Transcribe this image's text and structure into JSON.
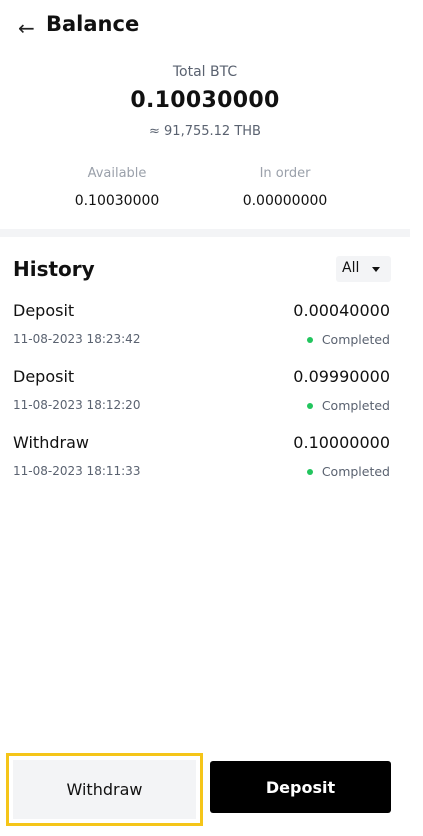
{
  "header": {
    "back_icon": "arrow-left-icon",
    "title": "Balance"
  },
  "summary": {
    "total_label": "Total BTC",
    "total_value": "0.10030000",
    "total_fiat": "≈ 91,755.12 THB",
    "available_label": "Available",
    "available_value": "0.10030000",
    "in_order_label": "In order",
    "in_order_value": "0.00000000"
  },
  "history": {
    "title": "History",
    "filter": {
      "selected": "All",
      "icon": "caret-down-icon"
    },
    "items": [
      {
        "type": "Deposit",
        "datetime": "11-08-2023  18:23:42",
        "amount": "0.00040000",
        "status": "Completed"
      },
      {
        "type": "Deposit",
        "datetime": "11-08-2023  18:12:20",
        "amount": "0.09990000",
        "status": "Completed"
      },
      {
        "type": "Withdraw",
        "datetime": "11-08-2023  18:11:33",
        "amount": "0.10000000",
        "status": "Completed"
      }
    ]
  },
  "actions": {
    "withdraw_label": "Withdraw",
    "deposit_label": "Deposit"
  },
  "colors": {
    "status_completed": "#22c55e",
    "highlight": "#f5c518",
    "deposit_button_bg": "#000000"
  }
}
